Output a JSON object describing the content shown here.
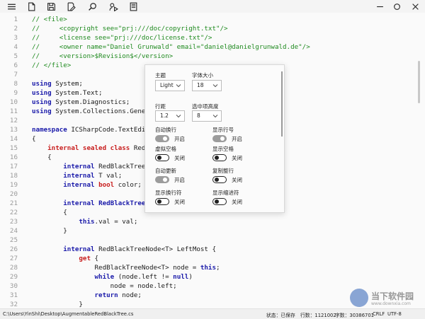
{
  "toolbar": {
    "icons": [
      "hamburger-menu-icon",
      "new-file-icon",
      "save-icon",
      "edit-icon",
      "search-icon",
      "run-icon",
      "document-icon"
    ]
  },
  "window": {
    "icons": [
      "minimize-icon",
      "restore-icon",
      "close-icon"
    ]
  },
  "editor": {
    "line_numbers": [
      "1",
      "2",
      "3",
      "4",
      "5",
      "6",
      "7",
      "8",
      "9",
      "10",
      "11",
      "12",
      "13",
      "14",
      "15",
      "16",
      "17",
      "18",
      "19",
      "20",
      "21",
      "22",
      "23",
      "24",
      "25",
      "26",
      "27",
      "28",
      "29",
      "30",
      "31",
      "32"
    ],
    "lines": [
      [
        {
          "t": "// <file>",
          "c": "cm"
        }
      ],
      [
        {
          "t": "//     <copyright see=\"prj:///doc/copyright.txt\"/>",
          "c": "cm"
        }
      ],
      [
        {
          "t": "//     <license see=\"prj:///doc/license.txt\"/>",
          "c": "cm"
        }
      ],
      [
        {
          "t": "//     <owner name=\"Daniel Grunwald\" email=\"daniel@danielgrunwald.de\"/>",
          "c": "cm"
        }
      ],
      [
        {
          "t": "//     <version>$Revision$</version>",
          "c": "cm"
        }
      ],
      [
        {
          "t": "// </file>",
          "c": "cm"
        }
      ],
      [],
      [
        {
          "t": "using",
          "c": "kw"
        },
        {
          "t": " System;",
          "c": ""
        }
      ],
      [
        {
          "t": "using",
          "c": "kw"
        },
        {
          "t": " System.Text;",
          "c": ""
        }
      ],
      [
        {
          "t": "using",
          "c": "kw"
        },
        {
          "t": " System.Diagnostics;",
          "c": ""
        }
      ],
      [
        {
          "t": "using",
          "c": "kw"
        },
        {
          "t": " System.Collections.Generic;",
          "c": ""
        }
      ],
      [],
      [
        {
          "t": "namespace",
          "c": "kw"
        },
        {
          "t": " ICSharpCode.TextEditor.Util",
          "c": ""
        }
      ],
      [
        {
          "t": "{",
          "c": ""
        }
      ],
      [
        {
          "t": "    ",
          "c": ""
        },
        {
          "t": "internal sealed class",
          "c": "kr"
        },
        {
          "t": " RedBlackTreeNode<T>",
          "c": ""
        }
      ],
      [
        {
          "t": "    {",
          "c": ""
        }
      ],
      [
        {
          "t": "        ",
          "c": ""
        },
        {
          "t": "internal",
          "c": "kw"
        },
        {
          "t": " RedBlackTreeNode<T> left, right, parent;",
          "c": ""
        }
      ],
      [
        {
          "t": "        ",
          "c": ""
        },
        {
          "t": "internal",
          "c": "kw"
        },
        {
          "t": " T val;",
          "c": ""
        }
      ],
      [
        {
          "t": "        ",
          "c": ""
        },
        {
          "t": "internal",
          "c": "kw"
        },
        {
          "t": " ",
          "c": ""
        },
        {
          "t": "bool",
          "c": "kr"
        },
        {
          "t": " color;",
          "c": ""
        }
      ],
      [],
      [
        {
          "t": "        ",
          "c": ""
        },
        {
          "t": "internal",
          "c": "kw"
        },
        {
          "t": " ",
          "c": ""
        },
        {
          "t": "RedBlackTreeNode(T val)",
          "c": "kw"
        }
      ],
      [
        {
          "t": "        {",
          "c": ""
        }
      ],
      [
        {
          "t": "            ",
          "c": ""
        },
        {
          "t": "this",
          "c": "kw"
        },
        {
          "t": ".val = val;",
          "c": ""
        }
      ],
      [
        {
          "t": "        }",
          "c": ""
        }
      ],
      [],
      [
        {
          "t": "        ",
          "c": ""
        },
        {
          "t": "internal",
          "c": "kw"
        },
        {
          "t": " RedBlackTreeNode<T> LeftMost {",
          "c": ""
        }
      ],
      [
        {
          "t": "            ",
          "c": ""
        },
        {
          "t": "get",
          "c": "kr"
        },
        {
          "t": " {",
          "c": ""
        }
      ],
      [
        {
          "t": "                RedBlackTreeNode<T> node = ",
          "c": ""
        },
        {
          "t": "this",
          "c": "kw"
        },
        {
          "t": ";",
          "c": ""
        }
      ],
      [
        {
          "t": "                ",
          "c": ""
        },
        {
          "t": "while",
          "c": "kw"
        },
        {
          "t": " (node.left != ",
          "c": ""
        },
        {
          "t": "null",
          "c": "kw"
        },
        {
          "t": ")",
          "c": ""
        }
      ],
      [
        {
          "t": "                    node = node.left;",
          "c": ""
        }
      ],
      [
        {
          "t": "                ",
          "c": ""
        },
        {
          "t": "return",
          "c": "kw"
        },
        {
          "t": " node;",
          "c": ""
        }
      ],
      [
        {
          "t": "            }",
          "c": ""
        }
      ]
    ]
  },
  "settings": {
    "theme_label": "主题",
    "theme_value": "Light",
    "font_size_label": "字体大小",
    "font_size_value": "18",
    "line_spacing_label": "行距",
    "line_spacing_value": "1.2",
    "selection_height_label": "选中项高度",
    "selection_height_value": "8",
    "toggles": [
      {
        "label": "自动换行",
        "state": "开启",
        "on": true
      },
      {
        "label": "显示行号",
        "state": "开启",
        "on": true
      },
      {
        "label": "虚拟空格",
        "state": "关闭",
        "on": false
      },
      {
        "label": "显示空格",
        "state": "关闭",
        "on": false
      },
      {
        "label": "自动更新",
        "state": "开启",
        "on": true
      },
      {
        "label": "复制整行",
        "state": "关闭",
        "on": false
      },
      {
        "label": "显示换行符",
        "state": "关闭",
        "on": false
      },
      {
        "label": "显示缩进符",
        "state": "关闭",
        "on": false
      }
    ]
  },
  "status": {
    "path": "C:\\Users\\YinShi\\Desktop\\AugmentableRedBlackTree.cs",
    "state": "状态：已保存",
    "lines": "行数：1121002",
    "chars": "字数：30386701",
    "eol": "CRLF",
    "encoding": "UTF-8"
  },
  "watermark": {
    "text": "当下软件园",
    "sub": "www.downxia.com"
  }
}
